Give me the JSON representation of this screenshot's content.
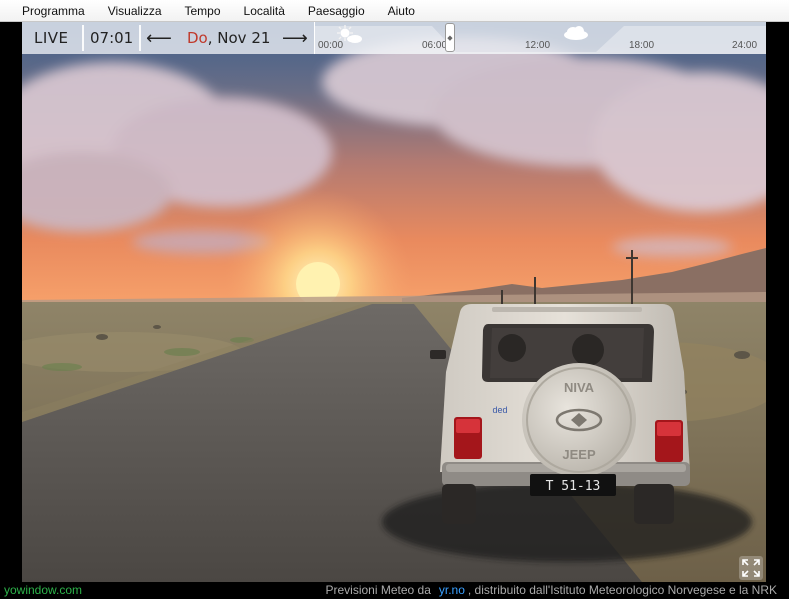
{
  "menu": {
    "items": [
      "Programma",
      "Visualizza",
      "Tempo",
      "Località",
      "Paesaggio",
      "Aiuto"
    ]
  },
  "timebar": {
    "live_label": "LIVE",
    "time": "07:01",
    "day": "Do",
    "date": ", Nov 21",
    "ticks": [
      "00:00",
      "06:00",
      "12:00",
      "18:00",
      "24:00"
    ],
    "weather_icons": [
      "sun-cloud-icon",
      "cloud-icon"
    ]
  },
  "vehicle": {
    "plate": "T 51-13",
    "spare_cover_top": "NIVA",
    "spare_cover_bottom": "JEEP",
    "sticker": "ded"
  },
  "footer": {
    "brand": "yowindow.com",
    "credit_prefix": "Previsioni Meteo da",
    "credit_source": "yr.no",
    "credit_suffix": ", distribuito dall'Istituto Meteorologico Norvegese e la NRK"
  },
  "colors": {
    "accent_day": "#c0392b",
    "brand_green": "#2db34a",
    "link_blue": "#3aa0ff"
  }
}
